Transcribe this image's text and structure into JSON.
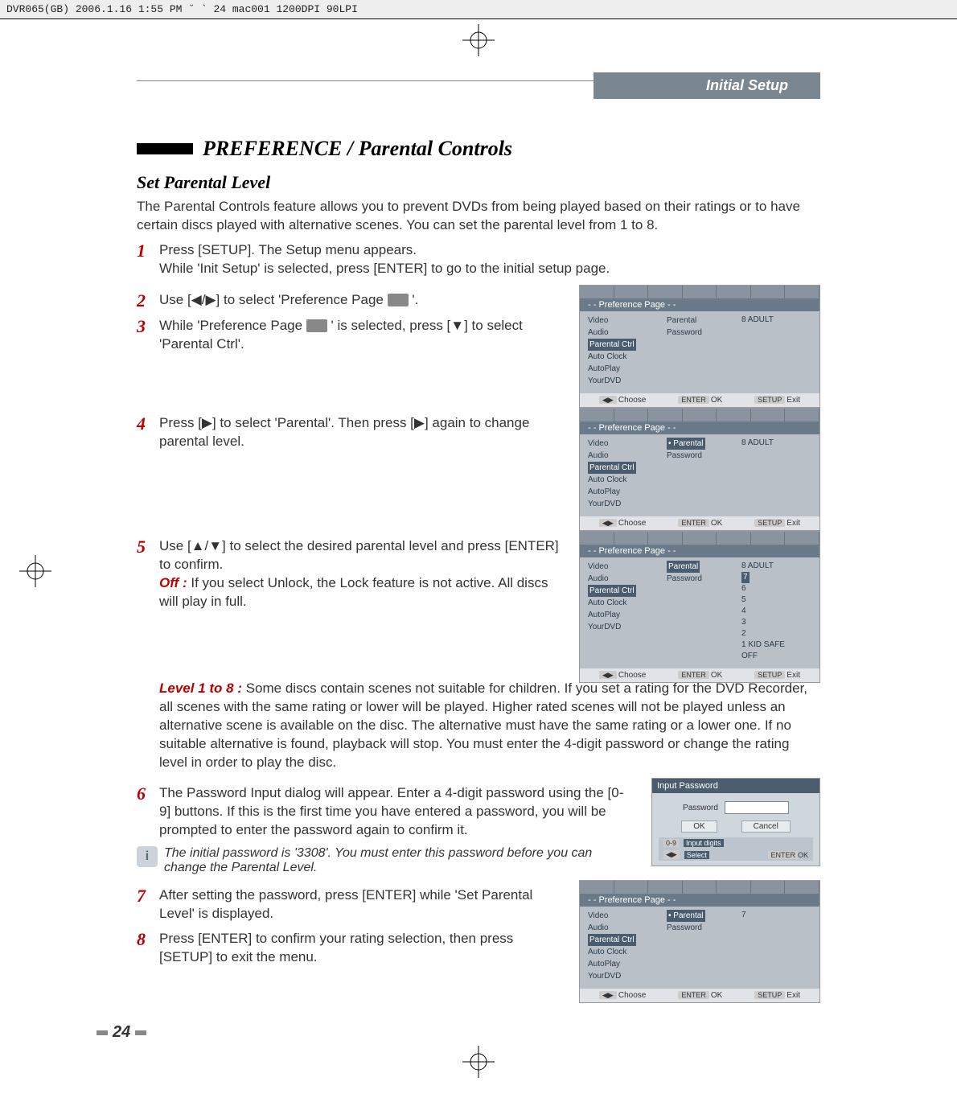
{
  "header_line": "DVR065(GB)  2006.1.16 1:55 PM  ˘   ` 24   mac001   1200DPI 90LPI",
  "chapter": "Initial Setup",
  "section_title": "PREFERENCE / Parental Controls",
  "sub_title": "Set Parental Level",
  "intro": "The Parental Controls feature allows you to prevent DVDs from being played based on their ratings or to have certain discs played with alternative scenes. You can set the parental level from 1 to 8.",
  "steps": {
    "s1": {
      "num": "1",
      "a": "Press [SETUP].  The Setup menu appears.",
      "b": "While 'Init Setup' is selected, press [ENTER] to go to the initial setup page."
    },
    "s2": {
      "num": "2",
      "a": "Use [◀/▶] to select 'Preference Page ",
      "b": "'."
    },
    "s3": {
      "num": "3",
      "a": "While 'Preference Page ",
      "b": "' is selected, press [▼] to select 'Parental Ctrl'."
    },
    "s4": {
      "num": "4",
      "a": "Press [▶] to select 'Parental'. Then press [▶] again to change parental level."
    },
    "s5": {
      "num": "5",
      "a": "Use [▲/▼] to select the desired parental level and press [ENTER] to confirm.",
      "off_label": "Off :",
      "off_text": " If you select Unlock, the Lock feature is not active. All discs will play in full.",
      "lvl_label": "Level 1 to 8 :",
      "lvl_text": " Some discs contain scenes not suitable for children. If you set a rating for the DVD Recorder, all scenes with the same rating or lower will be played. Higher rated scenes will not be played unless an alternative scene is available on the disc. The alternative must have the same rating or a lower one. If no suitable alternative is found, playback will stop. You must enter the 4-digit password or change the rating level in order to play the disc."
    },
    "s6": {
      "num": "6",
      "a": "The Password Input dialog will appear. Enter a 4-digit password using the [0-9] buttons. If this is the first time you have entered a password, you will be prompted to enter the password again to confirm it."
    },
    "s7": {
      "num": "7",
      "a": "After setting the password, press [ENTER] while 'Set Parental Level' is displayed."
    },
    "s8": {
      "num": "8",
      "a": "Press [ENTER] to confirm your rating selection, then press [SETUP] to exit the menu."
    }
  },
  "note": "The initial password is '3308'. You must enter this password before you can change the Parental Level.",
  "menu": {
    "head": "- - Preference Page - -",
    "items": [
      "Video",
      "Audio",
      "Parental Ctrl",
      "Auto Clock",
      "AutoPlay",
      "YourDVD"
    ],
    "col2": {
      "parental": "Parental",
      "password": "Password"
    },
    "col3_adult": "8 ADULT",
    "bar": {
      "choose": "Choose",
      "ok": "OK",
      "exit": "Exit"
    }
  },
  "levels": [
    "8 ADULT",
    "7",
    "6",
    "5",
    "4",
    "3",
    "2",
    "1 KID SAFE",
    "OFF"
  ],
  "level7": "7",
  "pw": {
    "title": "Input Password",
    "label": "Password",
    "ok": "OK",
    "cancel": "Cancel",
    "hint1": "Input digits",
    "hint2": "Select",
    "hint3": "OK"
  },
  "page_number": "24"
}
